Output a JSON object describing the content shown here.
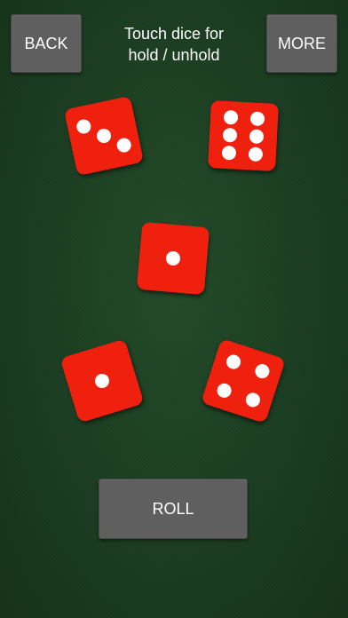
{
  "header": {
    "back_label": "BACK",
    "more_label": "MORE",
    "instruction_line1": "Touch dice for",
    "instruction_line2": "hold / unhold"
  },
  "dice": [
    {
      "value": 3
    },
    {
      "value": 6
    },
    {
      "value": 1
    },
    {
      "value": 1
    },
    {
      "value": 4
    }
  ],
  "roll_label": "ROLL",
  "colors": {
    "table_felt": "#1c3f22",
    "die_face": "#f0200f",
    "pip": "#ffffff",
    "button": "#5f5f5f"
  }
}
